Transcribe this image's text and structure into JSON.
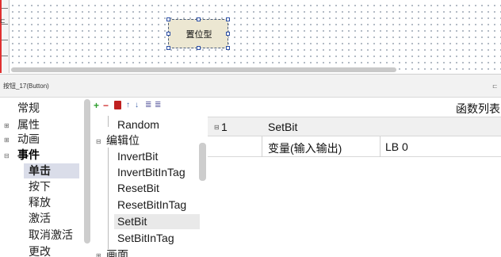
{
  "canvas": {
    "widget_label": "置位型"
  },
  "panel": {
    "title": "按钮_17(Button)"
  },
  "categories": [
    {
      "label": "常规",
      "marker": ""
    },
    {
      "label": "属性",
      "marker": "⊞"
    },
    {
      "label": "动画",
      "marker": "⊞"
    },
    {
      "label": "事件",
      "marker": "⊟"
    },
    {
      "label": "单击",
      "marker": ""
    },
    {
      "label": "按下",
      "marker": ""
    },
    {
      "label": "释放",
      "marker": ""
    },
    {
      "label": "激活",
      "marker": ""
    },
    {
      "label": "取消激活",
      "marker": ""
    },
    {
      "label": "更改",
      "marker": ""
    }
  ],
  "toolbar": {
    "add_icon": "+",
    "remove_icon": "−",
    "delete_icon": "🗑",
    "up_icon": "↑",
    "down_icon": "↓",
    "list_icon": "≣",
    "list2_icon": "≣"
  },
  "functions": {
    "random": "Random",
    "group_edit_bits": "编辑位",
    "invert_bit": "InvertBit",
    "invert_bit_in_tag": "InvertBitInTag",
    "reset_bit": "ResetBit",
    "reset_bit_in_tag": "ResetBitInTag",
    "set_bit": "SetBit",
    "set_bit_in_tag": "SetBitInTag",
    "group_screen": "画面"
  },
  "detail": {
    "header": "函数列表",
    "row_number": "1",
    "function_name": "SetBit",
    "param_label": "变量(输入输出)",
    "param_value": "LB 0"
  },
  "colors": {
    "selected_category_bg": "#dadde9",
    "widget_bg": "#ece7d2",
    "add_icon": "#2e9e2e",
    "remove_icon": "#d03030",
    "delete_icon": "#c02020",
    "arrow_icon": "#3a5fa8"
  }
}
